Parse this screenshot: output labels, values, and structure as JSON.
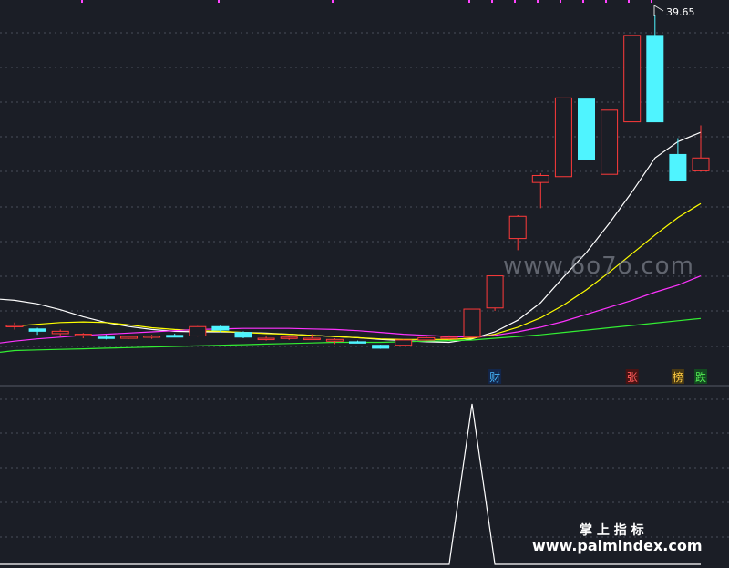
{
  "chart_data": {
    "type": "candlestick",
    "price_label": "39.65",
    "candles": [
      {
        "o": 12.95,
        "h": 13.3,
        "l": 12.7,
        "c": 13.05
      },
      {
        "o": 12.75,
        "h": 12.85,
        "l": 12.25,
        "c": 12.55
      },
      {
        "o": 12.35,
        "h": 12.7,
        "l": 12.15,
        "c": 12.55
      },
      {
        "o": 12.2,
        "h": 12.4,
        "l": 11.95,
        "c": 12.3
      },
      {
        "o": 12.05,
        "h": 12.25,
        "l": 11.85,
        "c": 11.95
      },
      {
        "o": 11.95,
        "h": 12.15,
        "l": 11.9,
        "c": 12.1
      },
      {
        "o": 12.05,
        "h": 12.25,
        "l": 11.9,
        "c": 12.15
      },
      {
        "o": 12.2,
        "h": 12.35,
        "l": 12.05,
        "c": 12.05
      },
      {
        "o": 12.15,
        "h": 13.0,
        "l": 12.1,
        "c": 12.95
      },
      {
        "o": 12.95,
        "h": 13.1,
        "l": 12.45,
        "c": 12.65
      },
      {
        "o": 12.45,
        "h": 12.55,
        "l": 11.95,
        "c": 12.05
      },
      {
        "o": 11.85,
        "h": 12.1,
        "l": 11.75,
        "c": 11.95
      },
      {
        "o": 11.95,
        "h": 12.1,
        "l": 11.8,
        "c": 12.05
      },
      {
        "o": 11.9,
        "h": 12.3,
        "l": 11.8,
        "c": 11.95
      },
      {
        "o": 11.7,
        "h": 11.95,
        "l": 11.45,
        "c": 11.85
      },
      {
        "o": 11.65,
        "h": 11.75,
        "l": 11.55,
        "c": 11.6
      },
      {
        "o": 11.35,
        "h": 11.4,
        "l": 11.05,
        "c": 11.1
      },
      {
        "o": 11.35,
        "h": 11.85,
        "l": 11.3,
        "c": 11.8
      },
      {
        "o": 11.8,
        "h": 12.1,
        "l": 11.7,
        "c": 12.0
      },
      {
        "o": 12.0,
        "h": 12.2,
        "l": 11.85,
        "c": 12.05
      },
      {
        "o": 12.05,
        "h": 14.45,
        "l": 12.0,
        "c": 14.45
      },
      {
        "o": 14.55,
        "h": 17.3,
        "l": 14.3,
        "c": 17.3
      },
      {
        "o": 20.5,
        "h": 22.5,
        "l": 19.5,
        "c": 22.4
      },
      {
        "o": 25.3,
        "h": 26.1,
        "l": 23.1,
        "c": 25.9
      },
      {
        "o": 25.8,
        "h": 32.55,
        "l": 25.8,
        "c": 32.55
      },
      {
        "o": 32.45,
        "h": 32.45,
        "l": 27.3,
        "c": 27.3
      },
      {
        "o": 26.0,
        "h": 31.5,
        "l": 26.0,
        "c": 31.5
      },
      {
        "o": 30.5,
        "h": 37.9,
        "l": 30.5,
        "c": 37.9
      },
      {
        "o": 37.9,
        "h": 39.65,
        "l": 30.5,
        "c": 30.5
      },
      {
        "o": 27.7,
        "h": 29.1,
        "l": 25.5,
        "c": 25.5
      },
      {
        "o": 26.3,
        "h": 30.2,
        "l": 26.3,
        "c": 27.4
      }
    ],
    "ma_lines": [
      {
        "color": "#ffffff",
        "values": [
          15.2,
          14.9,
          14.4,
          13.8,
          13.3,
          12.95,
          12.7,
          12.55,
          12.5,
          12.5,
          12.45,
          12.4,
          12.3,
          12.2,
          12.1,
          12.0,
          11.85,
          11.75,
          11.65,
          11.6,
          11.9,
          12.5,
          13.5,
          15.0,
          17.2,
          19.3,
          21.8,
          24.5,
          27.4,
          28.8,
          29.6
        ]
      },
      {
        "color": "#ffff00",
        "values": [
          13.0,
          13.15,
          13.3,
          13.35,
          13.3,
          13.1,
          12.85,
          12.7,
          12.6,
          12.55,
          12.45,
          12.35,
          12.3,
          12.2,
          12.1,
          12.0,
          11.9,
          11.85,
          11.85,
          11.85,
          11.95,
          12.3,
          12.9,
          13.7,
          14.8,
          16.1,
          17.6,
          19.2,
          20.8,
          22.3,
          23.5
        ]
      },
      {
        "color": "#ff33ff",
        "values": [
          11.7,
          11.9,
          12.05,
          12.2,
          12.3,
          12.4,
          12.5,
          12.6,
          12.7,
          12.75,
          12.8,
          12.8,
          12.8,
          12.75,
          12.7,
          12.6,
          12.45,
          12.3,
          12.2,
          12.1,
          12.05,
          12.2,
          12.5,
          12.9,
          13.4,
          14.0,
          14.6,
          15.2,
          15.9,
          16.5,
          17.3
        ]
      },
      {
        "color": "#33ee33",
        "values": [
          10.9,
          10.95,
          11.0,
          11.05,
          11.1,
          11.15,
          11.2,
          11.25,
          11.3,
          11.35,
          11.4,
          11.45,
          11.5,
          11.55,
          11.6,
          11.6,
          11.6,
          11.65,
          11.7,
          11.75,
          11.8,
          11.95,
          12.1,
          12.25,
          12.45,
          12.65,
          12.85,
          13.05,
          13.25,
          13.45,
          13.65
        ]
      }
    ],
    "signals": [
      {
        "index": 21,
        "text": "财",
        "color": "#48b8ff",
        "bg": "#13264a"
      },
      {
        "index": 27,
        "text": "张",
        "color": "#ff5a5a",
        "bg": "#4a1313"
      },
      {
        "index": 29,
        "text": "榜",
        "color": "#ffcc44",
        "bg": "#4a3a13"
      },
      {
        "index": 30,
        "text": "跌",
        "color": "#55ee55",
        "bg": "#134a20"
      }
    ],
    "indicator": {
      "values": [
        0,
        0,
        0,
        0,
        0,
        0,
        0,
        0,
        0,
        0,
        0,
        0,
        0,
        0,
        0,
        0,
        0,
        0,
        0,
        0,
        1,
        0,
        0,
        0,
        0,
        0,
        0,
        0,
        0,
        0,
        0
      ],
      "color": "#ffffff"
    },
    "colors": {
      "up": "#ff3a3a",
      "down": "#4ff4ff",
      "grid": "#4a4f5a",
      "bg": "#1b1e26"
    }
  },
  "watermarks": {
    "center": "www.6o7o.com",
    "title": "掌 上 指 标",
    "url": "www.palmindex.com"
  }
}
